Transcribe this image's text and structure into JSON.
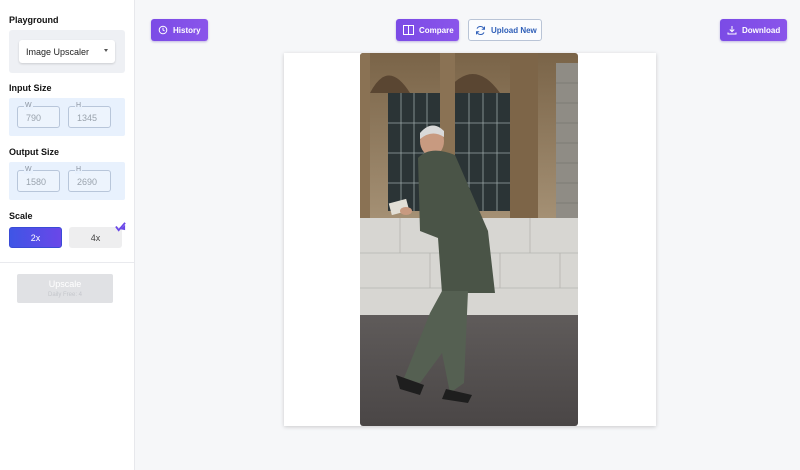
{
  "sidebar": {
    "playground_label": "Playground",
    "tool_select_value": "Image Upscaler",
    "input_size": {
      "title": "Input Size",
      "w_label": "W",
      "w_value": "790",
      "h_label": "H",
      "h_value": "1345"
    },
    "output_size": {
      "title": "Output Size",
      "w_label": "W",
      "w_value": "1580",
      "h_label": "H",
      "h_value": "2690"
    },
    "scale": {
      "title": "Scale",
      "options": [
        "2x",
        "4x"
      ],
      "selected": "2x"
    },
    "upscale_button": {
      "label": "Upscale",
      "sublabel": "Daily Free: 4"
    }
  },
  "toolbar": {
    "history_label": "History",
    "compare_label": "Compare",
    "upload_new_label": "Upload New",
    "download_label": "Download"
  },
  "icons": {
    "history": "history-icon",
    "compare": "compare-icon",
    "upload": "refresh-icon",
    "download": "download-icon",
    "pro": "pro-badge-icon"
  },
  "colors": {
    "primary_purple": "#7b4be6",
    "scale_selected": "#4a50e6",
    "outline_text": "#2f5fb8",
    "size_box_bg": "#e8f1fd"
  }
}
